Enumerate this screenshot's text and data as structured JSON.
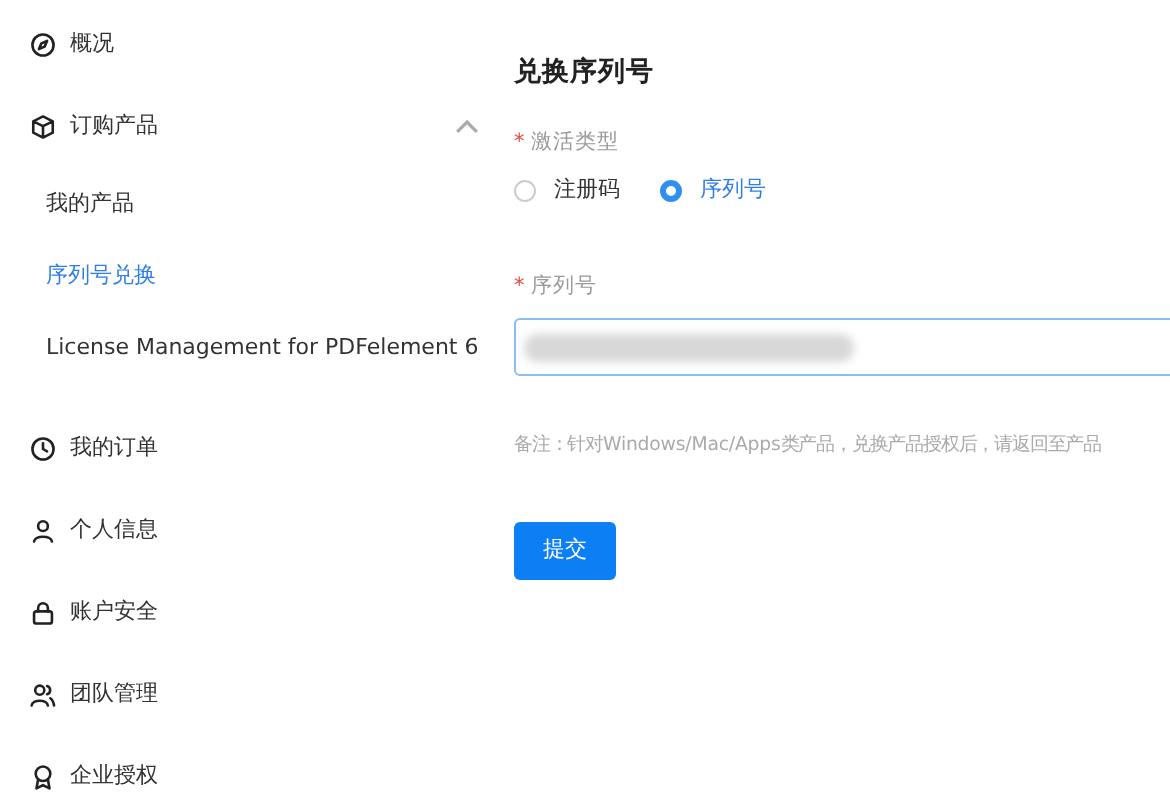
{
  "sidebar": {
    "items": [
      {
        "label": "概况",
        "kind": "compass",
        "selected": false
      },
      {
        "label": "订购产品",
        "kind": "cube",
        "selected": false,
        "expanded": true,
        "children": [
          {
            "label": "我的产品",
            "selected": false
          },
          {
            "label": "序列号兑换",
            "selected": true
          },
          {
            "label": "License Management for PDFelement 6",
            "selected": false
          }
        ]
      },
      {
        "label": "我的订单",
        "kind": "clock",
        "selected": false
      },
      {
        "label": "个人信息",
        "kind": "person",
        "selected": false
      },
      {
        "label": "账户安全",
        "kind": "lock",
        "selected": false
      },
      {
        "label": "团队管理",
        "kind": "people",
        "selected": false
      },
      {
        "label": "企业授权",
        "kind": "award",
        "selected": false
      }
    ]
  },
  "form": {
    "title": "兑换序列号",
    "activation_type": {
      "required_mark": "*",
      "label": "激活类型",
      "options": [
        {
          "label": "注册码",
          "selected": false
        },
        {
          "label": "序列号",
          "selected": true
        }
      ]
    },
    "serial": {
      "required_mark": "*",
      "label": "序列号",
      "value_redacted": true
    },
    "note": "备注：针对Windows/Mac/Apps类产品，兑换产品授权后，请返回至产品",
    "submit": "提交"
  }
}
